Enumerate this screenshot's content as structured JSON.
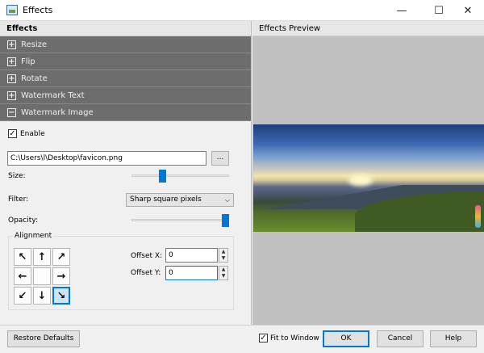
{
  "window": {
    "title": "Effects",
    "minimize_glyph": "—",
    "maximize_glyph": "☐",
    "close_glyph": "✕"
  },
  "left_panel": {
    "header": "Effects",
    "sections": [
      {
        "label": "Resize",
        "expanded": false,
        "glyph": "+"
      },
      {
        "label": "Flip",
        "expanded": false,
        "glyph": "+"
      },
      {
        "label": "Rotate",
        "expanded": false,
        "glyph": "+"
      },
      {
        "label": "Watermark Text",
        "expanded": false,
        "glyph": "+"
      },
      {
        "label": "Watermark Image",
        "expanded": true,
        "glyph": "−"
      }
    ],
    "watermark_image": {
      "enable_label": "Enable",
      "enable_checked": true,
      "check_glyph": "✓",
      "path_value": "C:\\Users\\l\\Desktop\\favicon.png",
      "browse_label": "...",
      "size_label": "Size:",
      "size_level": 0.3,
      "filter_label": "Filter:",
      "filter_value": "Sharp square pixels",
      "opacity_label": "Opacity:",
      "opacity_level": 1.0,
      "alignment_title": "Alignment",
      "alignment_buttons": [
        {
          "glyph": "↖",
          "name": "top-left"
        },
        {
          "glyph": "↑",
          "name": "top"
        },
        {
          "glyph": "↗",
          "name": "top-right"
        },
        {
          "glyph": "←",
          "name": "left"
        },
        {
          "glyph": "",
          "name": "center"
        },
        {
          "glyph": "→",
          "name": "right"
        },
        {
          "glyph": "↙",
          "name": "bottom-left"
        },
        {
          "glyph": "↓",
          "name": "bottom"
        },
        {
          "glyph": "↘",
          "name": "bottom-right"
        }
      ],
      "selected_alignment": "bottom-right",
      "offset_x_label": "Offset X:",
      "offset_x_value": "0",
      "offset_y_label": "Offset Y:",
      "offset_y_value": "0",
      "spin_up": "▲",
      "spin_down": "▼"
    }
  },
  "right_panel": {
    "header": "Effects Preview"
  },
  "footer": {
    "restore_label": "Restore Defaults",
    "fit_label": "Fit to Window",
    "fit_checked": true,
    "ok_label": "OK",
    "cancel_label": "Cancel",
    "help_label": "Help"
  },
  "colors": {
    "accent": "#0078d7",
    "section_bg": "#6d6d6d",
    "preview_bg": "#c0c0c0"
  }
}
